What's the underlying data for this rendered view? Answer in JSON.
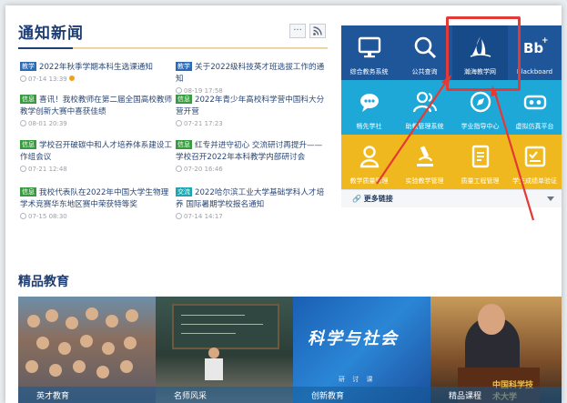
{
  "news": {
    "title": "通知新闻",
    "more_icon": "ellipsis-icon",
    "rss_icon": "rss-icon",
    "items": [
      {
        "badge": "教学",
        "title": "2022年秋季学期本科生选课通知",
        "date": "07-14 13:39",
        "hot": true,
        "badge_color": "#2d6bb5"
      },
      {
        "badge": "教学",
        "title": "关于2022级科技英才班选拔工作的通知",
        "date": "08-19 17:58",
        "hot": false,
        "badge_color": "#2d6bb5"
      },
      {
        "badge": "信息",
        "title": "喜讯！我校教师在第二届全国高校教师教学创新大赛中喜获佳绩",
        "date": "08-01 20:39",
        "hot": false,
        "badge_color": "#3a9a3f"
      },
      {
        "badge": "信息",
        "title": "2022年青少年高校科学营中国科大分营开营",
        "date": "07-21 17:23",
        "hot": false,
        "badge_color": "#3a9a3f"
      },
      {
        "badge": "信息",
        "title": "学校召开破碳中和人才培养体系建设工作组会议",
        "date": "07-21 12:48",
        "hot": false,
        "badge_color": "#3a9a3f"
      },
      {
        "badge": "信息",
        "title": "红专并进守初心 交流研讨再提升——学校召开2022年本科教学内部研讨会",
        "date": "07-20 16:46",
        "hot": false,
        "badge_color": "#3a9a3f"
      },
      {
        "badge": "信息",
        "title": "我校代表队在2022年中国大学生物理学术竞赛华东地区赛中荣获特等奖",
        "date": "07-15 08:30",
        "hot": false,
        "badge_color": "#3a9a3f"
      },
      {
        "badge": "交流",
        "title": "2022哈尔滨工业大学基础学科人才培养 国际暑期学校报名通知",
        "date": "07-14 14:17",
        "hot": false,
        "badge_color": "#1aa7b0"
      }
    ]
  },
  "quicklinks": {
    "tiles": [
      {
        "label": "综合教务系统",
        "icon": "monitor-icon"
      },
      {
        "label": "公共查询",
        "icon": "search-icon"
      },
      {
        "label": "瀚海教学网",
        "icon": "sail-logo-icon"
      },
      {
        "label": "Blackboard",
        "icon": "bb-logo-icon"
      },
      {
        "label": "畅先学社",
        "icon": "chat-bubble-icon"
      },
      {
        "label": "助教管理系统",
        "icon": "users-icon"
      },
      {
        "label": "学业指导中心",
        "icon": "compass-icon"
      },
      {
        "label": "虚拟仿真平台",
        "icon": "vr-headset-icon"
      },
      {
        "label": "教学质量管理",
        "icon": "person-icon"
      },
      {
        "label": "实验教学管理",
        "icon": "microscope-icon"
      },
      {
        "label": "质量工程管理",
        "icon": "document-icon"
      },
      {
        "label": "学生成绩单验证",
        "icon": "checklist-icon"
      }
    ],
    "more_label": "更多链接",
    "colors": {
      "row1": "#1e5699",
      "row2": "#1ea8d8",
      "row3": "#f0b81f",
      "highlight": "#e53935"
    }
  },
  "featured": {
    "title": "精品教育",
    "panels": [
      {
        "caption": "英才教育"
      },
      {
        "caption": "名师风采"
      },
      {
        "caption": "创新教育",
        "banner_title": "科学与社会",
        "banner_sub": "研 讨 课"
      },
      {
        "caption": "精品课程",
        "podium_text": "中国科学技术大学"
      }
    ]
  }
}
